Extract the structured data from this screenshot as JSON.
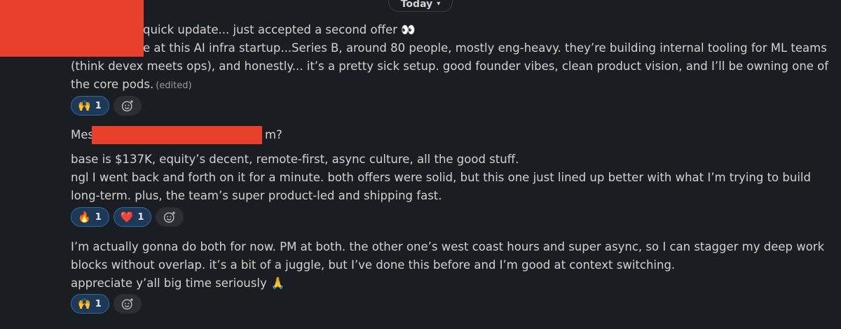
{
  "day_divider": {
    "label": "Today",
    "chevron_icon": "chevron-down-icon"
  },
  "messages": [
    {
      "lines": [
        "quick update... just accepted a second offer 👀",
        "e at this AI infra startup...Series B, around 80 people, mostly eng-heavy. they’re building internal tooling for ML teams",
        "(think devex meets ops), and honestly... it’s a pretty sick setup. good founder vibes, clean product vision, and I’ll be owning one of",
        "the core pods."
      ],
      "edited_label": "(edited)",
      "reactions": [
        {
          "emoji": "🙌",
          "count": "1"
        }
      ]
    },
    {
      "lines": [
        "Mes",
        "m?"
      ]
    },
    {
      "lines": [
        "base is $137K, equity’s decent, remote-first, async culture, all the good stuff.",
        "ngl I went back and forth on it for a minute. both offers were solid, but this one just lined up better with what I’m trying to build",
        "long-term. plus, the team’s super product-led and shipping fast."
      ],
      "reactions": [
        {
          "emoji": "🔥",
          "count": "1"
        },
        {
          "emoji": "❤️",
          "count": "1"
        }
      ]
    },
    {
      "lines": [
        "I’m actually gonna do both for now. PM at both. the other one’s west coast hours and super async, so I can stagger my deep work",
        "blocks without overlap. it’s a bit of a juggle, but I’ve done this before and I’m good at context switching.",
        "appreciate y’all big time seriously 🙏"
      ],
      "reactions": [
        {
          "emoji": "🙌",
          "count": "1"
        }
      ]
    }
  ],
  "add_reaction_icon": "add-reaction-icon",
  "colors": {
    "background": "#1a1d21",
    "text": "#d1d2d3",
    "redaction": "#e8402a",
    "reaction_bg": "#1d3958",
    "reaction_border": "#2f6aa3"
  }
}
